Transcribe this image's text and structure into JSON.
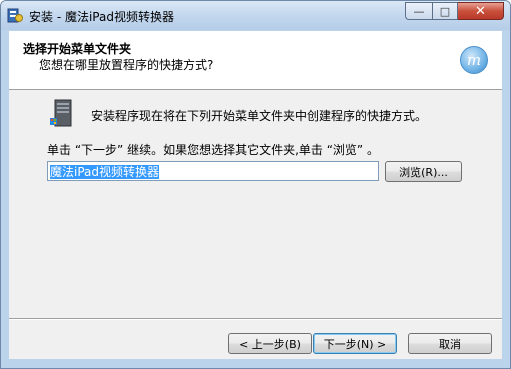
{
  "window": {
    "title": "安装 - 魔法iPad视频转换器",
    "minimize_glyph": "—",
    "maximize_glyph": "□",
    "close_glyph": "✕"
  },
  "header": {
    "title": "选择开始菜单文件夹",
    "subtitle": "您想在哪里放置程序的快捷方式?",
    "logo_glyph": "m"
  },
  "body": {
    "info_text": "安装程序现在将在下列开始菜单文件夹中创建程序的快捷方式。",
    "instruction_text": "单击 “下一步” 继续。如果您想选择其它文件夹,单击 “浏览” 。",
    "folder_value": "魔法iPad视频转换器",
    "browse_label": "浏览(R)..."
  },
  "footer": {
    "back_label": "< 上一步(B)",
    "next_label": "下一步(N) >",
    "cancel_label": "取消"
  },
  "colors": {
    "selection": "#3399ff",
    "client_bg": "#f0f0f0",
    "frame": "#bcd3ec"
  }
}
